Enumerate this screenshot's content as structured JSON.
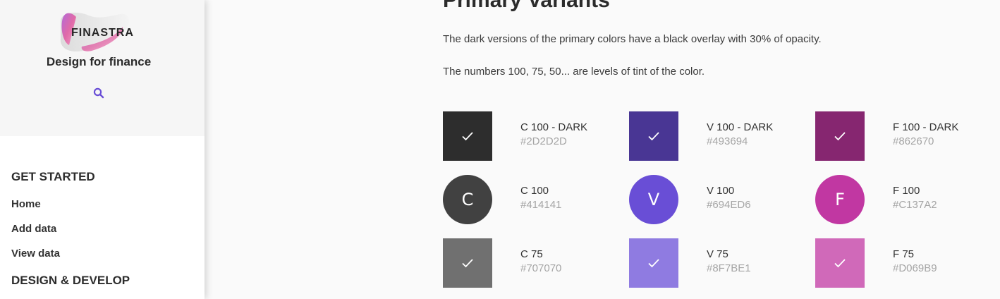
{
  "brand": {
    "logo_text": "FINASTRA",
    "tagline": "Design for finance",
    "search_icon": "search-icon"
  },
  "nav": {
    "sections": [
      {
        "title": "GET STARTED",
        "items": [
          {
            "label": "Home"
          },
          {
            "label": "Add data"
          },
          {
            "label": "View data"
          }
        ]
      },
      {
        "title": "DESIGN & DEVELOP",
        "items": []
      }
    ]
  },
  "main": {
    "heading": "Primary Variants",
    "paragraphs": [
      "The dark versions of the primary colors have a black overlay with 30% of opacity.",
      "The numbers 100, 75, 50... are levels of tint of the color."
    ],
    "rows": [
      {
        "kind": "square-check",
        "items": [
          {
            "name": "C 100 - DARK",
            "hex": "#2D2D2D",
            "color": "#2D2D2D"
          },
          {
            "name": "V 100 - DARK",
            "hex": "#493694",
            "color": "#493694"
          },
          {
            "name": "F 100 - DARK",
            "hex": "#862670",
            "color": "#862670"
          }
        ]
      },
      {
        "kind": "circle-letter",
        "items": [
          {
            "name": "C 100",
            "hex": "#414141",
            "color": "#414141",
            "letter": "C"
          },
          {
            "name": "V 100",
            "hex": "#694ED6",
            "color": "#694ED6",
            "letter": "V"
          },
          {
            "name": "F 100",
            "hex": "#C137A2",
            "color": "#C137A2",
            "letter": "F"
          }
        ]
      },
      {
        "kind": "square-check",
        "items": [
          {
            "name": "C 75",
            "hex": "#707070",
            "color": "#707070"
          },
          {
            "name": "V 75",
            "hex": "#8F7BE1",
            "color": "#8F7BE1"
          },
          {
            "name": "F 75",
            "hex": "#D069B9",
            "color": "#D069B9"
          }
        ]
      }
    ]
  },
  "colors": {
    "accent": "#694ED6",
    "sidebar_bg": "#FFFFFF",
    "brand_bg": "#F6F6F6",
    "page_bg": "#FAFAFA"
  }
}
